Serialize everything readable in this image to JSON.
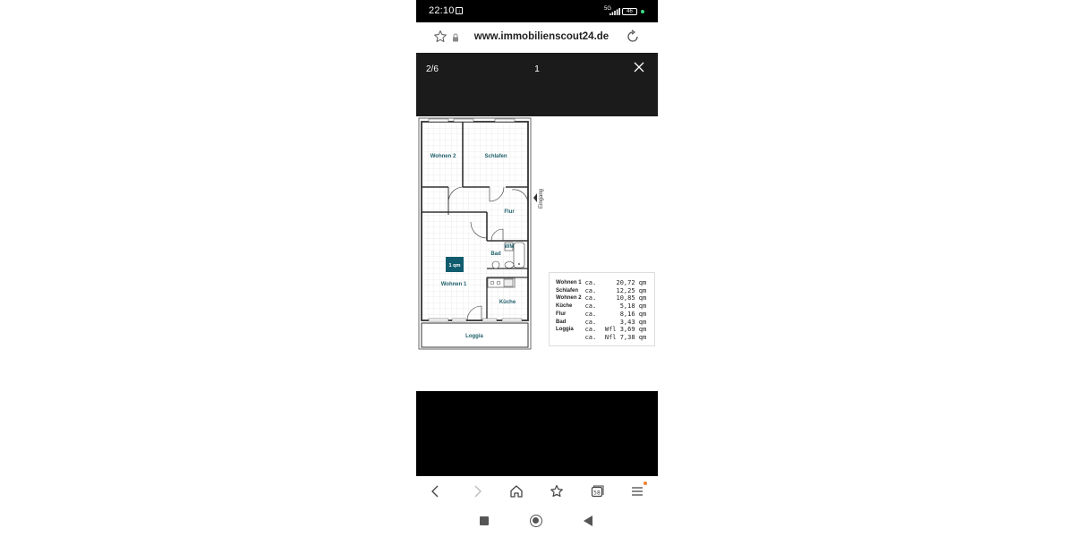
{
  "status_bar": {
    "time": "22:10",
    "signal_label": "5G",
    "battery": "46"
  },
  "url_bar": {
    "url": "www.immobilienscout24.de"
  },
  "viewer": {
    "counter": "2/6",
    "caption": "1"
  },
  "floorplan": {
    "rooms": {
      "wohnen2": "Wohnen 2",
      "schlafen": "Schlafen",
      "flur": "Flur",
      "eingang": "Eingang",
      "bad": "Bad",
      "wm": "WM",
      "wohnen1": "Wohnen 1",
      "kueche": "Küche",
      "loggia": "Loggia",
      "qm_badge": "1 qm"
    },
    "legend": [
      {
        "room": "Wohnen 1",
        "ca": "ca.",
        "value": "20,72 qm"
      },
      {
        "room": "Schlafen",
        "ca": "ca.",
        "value": "12,25 qm"
      },
      {
        "room": "Wohnen 2",
        "ca": "ca.",
        "value": "10,85 qm"
      },
      {
        "room": "Küche",
        "ca": "ca.",
        "value": "5,18 qm"
      },
      {
        "room": "Flur",
        "ca": "ca.",
        "value": "8,16 qm"
      },
      {
        "room": "Bad",
        "ca": "ca.",
        "value": "3,43 qm"
      },
      {
        "room": "Loggia",
        "ca": "ca.",
        "value": "Wfl 3,69 qm"
      },
      {
        "room": "",
        "ca": "ca.",
        "value": "Nfl 7,38 qm"
      }
    ]
  },
  "colors": {
    "room_label": "#1f5f6a",
    "qm_badge": "#0f5c6e",
    "notification_badge": "#f08030"
  }
}
